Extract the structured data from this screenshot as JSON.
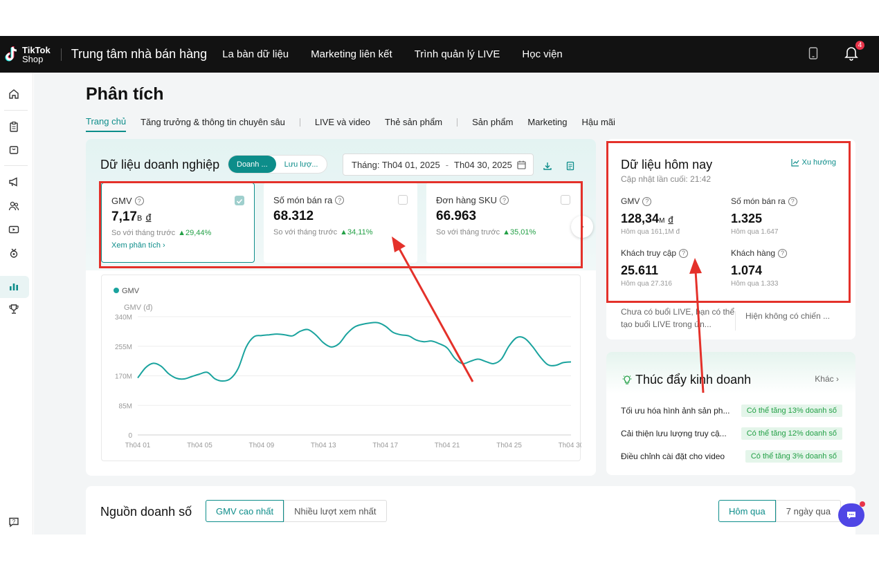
{
  "brand": {
    "line1": "TikTok",
    "line2": "Shop"
  },
  "header": {
    "title": "Trung tâm nhà bán hàng",
    "nav": [
      "La bàn dữ liệu",
      "Marketing liên kết",
      "Trình quản lý LIVE",
      "Học viện"
    ],
    "notification_count": "4"
  },
  "sidebar": {
    "icons": [
      "home-icon",
      "clipboard-icon",
      "box-icon",
      "megaphone-icon",
      "users-icon",
      "video-icon",
      "badge-icon",
      "analytics-icon",
      "trophy-icon",
      "help-icon"
    ],
    "active": "analytics-icon"
  },
  "page": {
    "title": "Phân tích",
    "tabs": [
      "Trang chủ",
      "Tăng trưởng & thông tin chuyên sâu",
      "LIVE và video",
      "Thẻ sản phẩm",
      "Sản phẩm",
      "Marketing",
      "Hậu mãi"
    ],
    "active_tab": "Trang chủ"
  },
  "business": {
    "title": "Dữ liệu doanh nghiệp",
    "toggle": [
      "Doanh ...",
      "Lưu lượ..."
    ],
    "date_label": "Tháng: Th04 01, 2025",
    "date_end": "Th04 30, 2025",
    "metrics": [
      {
        "label": "GMV",
        "value": "7,17",
        "unit": "B",
        "currency": "đ",
        "compare_label": "So với tháng trước",
        "change": "29,44%",
        "link": "Xem phân tích ›",
        "checked": true
      },
      {
        "label": "Số món bán ra",
        "value": "68.312",
        "compare_label": "So với tháng trước",
        "change": "34,11%",
        "checked": false
      },
      {
        "label": "Đơn hàng SKU",
        "value": "66.963",
        "compare_label": "So với tháng trước",
        "change": "35,01%",
        "checked": false
      }
    ]
  },
  "chart_data": {
    "type": "line",
    "legend": "GMV",
    "ylabel": "GMV (đ)",
    "y_ticks": [
      "340M",
      "255M",
      "170M",
      "85M",
      "0"
    ],
    "ylim": [
      0,
      340
    ],
    "x_ticks": [
      "Th04 01",
      "Th04 05",
      "Th04 09",
      "Th04 13",
      "Th04 17",
      "Th04 21",
      "Th04 25",
      "Th04 30"
    ],
    "x_tick_days": [
      1,
      5,
      9,
      13,
      17,
      21,
      25,
      29
    ],
    "series": [
      {
        "name": "GMV",
        "color": "#1aa39e",
        "x": [
          1,
          1.5,
          2,
          2.5,
          3,
          3.5,
          4,
          4.5,
          5,
          5.5,
          6,
          6.5,
          7,
          7.5,
          8,
          8.5,
          9,
          9.5,
          10,
          10.5,
          11,
          11.5,
          12,
          12.5,
          13,
          13.5,
          14,
          14.5,
          15,
          15.5,
          16,
          16.5,
          17,
          17.5,
          18,
          18.5,
          19,
          19.5,
          20,
          20.5,
          21,
          21.5,
          22,
          22.5,
          23,
          23.5,
          24,
          24.5,
          25,
          25.5,
          26,
          26.5,
          27,
          27.5,
          28,
          28.5,
          29
        ],
        "values": [
          164,
          193,
          206,
          198,
          176,
          163,
          161,
          168,
          175,
          180,
          161,
          155,
          162,
          192,
          252,
          282,
          286,
          288,
          290,
          288,
          285,
          298,
          303,
          288,
          265,
          253,
          262,
          290,
          310,
          318,
          322,
          323,
          313,
          295,
          288,
          285,
          273,
          268,
          270,
          262,
          250,
          220,
          205,
          212,
          218,
          211,
          205,
          218,
          256,
          280,
          278,
          255,
          225,
          202,
          200,
          208,
          210
        ]
      }
    ]
  },
  "today": {
    "title": "Dữ liệu hôm nay",
    "trend": "Xu hướng",
    "updated": "Cập nhật lần cuối: 21:42",
    "metrics": [
      {
        "label": "GMV",
        "value": "128,34",
        "unit": "M",
        "currency": "đ",
        "sub": "Hôm qua 161,1M đ"
      },
      {
        "label": "Số món bán ra",
        "value": "1.325",
        "sub": "Hôm qua 1.647"
      },
      {
        "label": "Khách truy cập",
        "value": "25.611",
        "sub": "Hôm qua 27.316"
      },
      {
        "label": "Khách hàng",
        "value": "1.074",
        "sub": "Hôm qua 1.333"
      }
    ],
    "live_note": "Chưa có buổi LIVE, bạn có thể tạo buổi LIVE trong ứn...",
    "campaign_note": "Hiện không có chiến ..."
  },
  "boost": {
    "title": "Thúc đẩy kinh doanh",
    "more": "Khác",
    "items": [
      {
        "text": "Tối ưu hóa hình ảnh sản ph...",
        "badge": "Có thể tăng 13% doanh số"
      },
      {
        "text": "Cải thiện lưu lượng truy cậ...",
        "badge": "Có thể tăng 12% doanh số"
      },
      {
        "text": "Điều chỉnh cài đặt cho video",
        "badge": "Có thể tăng 3% doanh số"
      }
    ]
  },
  "revenue": {
    "title": "Nguồn doanh số",
    "tabs": [
      "GMV cao nhất",
      "Nhiều lượt xem nhất"
    ],
    "ranges": [
      "Hôm qua",
      "7 ngày qua"
    ]
  },
  "colors": {
    "accent": "#0d8d8a",
    "highlight": "#e4312a",
    "positive": "#23a046",
    "chat": "#4f46e5"
  }
}
